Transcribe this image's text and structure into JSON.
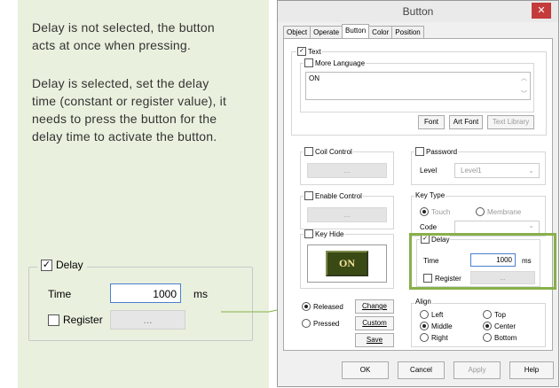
{
  "notes": {
    "p1_line1": "Delay is not selected, the button",
    "p1_line2": "acts at once when pressing.",
    "p2_line1": "Delay is selected, set the delay",
    "p2_line2": "time (constant or register value), it",
    "p2_line3": "needs to press the button for the",
    "p2_line4": "delay time to activate the button."
  },
  "zoom": {
    "delay_label": "Delay",
    "delay_checked": "✓",
    "time_label": "Time",
    "time_value": "1000",
    "unit": "ms",
    "register_label": "Register",
    "register_btn": "..."
  },
  "dialog": {
    "title": "Button",
    "close": "✕",
    "tabs": [
      "Object",
      "Operate",
      "Button",
      "Color",
      "Position"
    ],
    "text_group": {
      "label": "Text",
      "checked": "✓",
      "more_language": "More Language",
      "value": "ON",
      "font_btn": "Font",
      "art_font_btn": "Art Font",
      "text_library_btn": "Text Library"
    },
    "coil_control": {
      "label": "Coil Control",
      "btn": "..."
    },
    "password": {
      "label": "Password",
      "level_label": "Level",
      "level_value": "Level1"
    },
    "enable_control": {
      "label": "Enable Control",
      "btn": "..."
    },
    "key_type": {
      "label": "Key Type",
      "touch": "Touch",
      "membrane": "Membrane",
      "code_label": "Code"
    },
    "key_hide": {
      "label": "Key Hide",
      "preview_text": "ON"
    },
    "delay": {
      "label": "Delay",
      "checked": "✓",
      "time_label": "Time",
      "time_value": "1000",
      "unit": "ms",
      "register_label": "Register",
      "register_btn": "..."
    },
    "state": {
      "released": "Released",
      "pressed": "Pressed",
      "change_btn": "Change",
      "custom_btn": "Custom",
      "save_btn": "Save"
    },
    "align": {
      "label": "Align",
      "left": "Left",
      "top": "Top",
      "middle": "Middle",
      "center": "Center",
      "right": "Right",
      "bottom": "Bottom"
    },
    "buttons": {
      "ok": "OK",
      "cancel": "Cancel",
      "apply": "Apply",
      "help": "Help"
    }
  },
  "colors": {
    "panel_bg": "#e9f1de",
    "highlight": "#88b04b",
    "preview_bg": "#3a4a14",
    "preview_text": "#f6e79b"
  }
}
